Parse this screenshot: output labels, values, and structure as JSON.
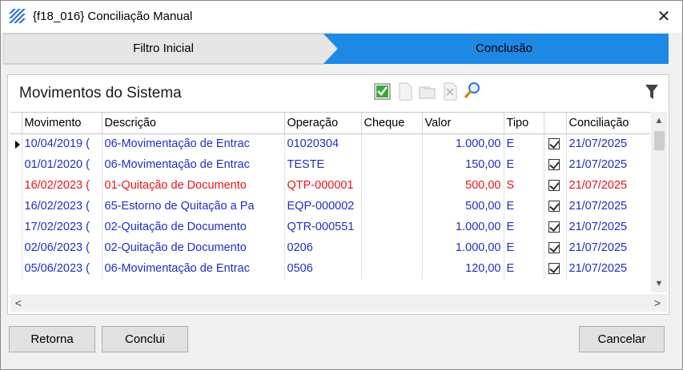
{
  "window": {
    "title": "{f18_016}  Conciliação Manual",
    "close_glyph": "✕",
    "icon": "app-logo-icon"
  },
  "wizard": {
    "steps": [
      {
        "label": "Filtro Inicial",
        "active": false
      },
      {
        "label": "Conclusão",
        "active": true
      }
    ],
    "active_color": "#1e88e5",
    "inactive_color": "#e6e6e6"
  },
  "panel": {
    "title": "Movimentos do Sistema",
    "toolbar_icons": [
      "check-all-icon",
      "new-document-icon",
      "open-folder-icon",
      "delete-document-icon",
      "search-icon"
    ],
    "filter_icon": "filter-icon"
  },
  "grid": {
    "columns": [
      "Movimento",
      "Descrição",
      "Operação",
      "Cheque",
      "Valor",
      "Tipo",
      "",
      "Conciliação"
    ],
    "rows": [
      {
        "movimento": "10/04/2019 (",
        "descricao": "06-Movimentação de Entrac",
        "operacao": "01020304",
        "cheque": "",
        "valor": "1.000,00",
        "tipo": "E",
        "checked": true,
        "conciliacao": "21/07/2025",
        "color": "#1f2fbf",
        "current": true
      },
      {
        "movimento": "01/01/2020 (",
        "descricao": "06-Movimentação de Entrac",
        "operacao": "TESTE",
        "cheque": "",
        "valor": "150,00",
        "tipo": "E",
        "checked": true,
        "conciliacao": "21/07/2025",
        "color": "#1f2fbf",
        "current": false
      },
      {
        "movimento": "16/02/2023 (",
        "descricao": "01-Quitação de Documento",
        "operacao": "QTP-000001",
        "cheque": "",
        "valor": "500,00",
        "tipo": "S",
        "checked": true,
        "conciliacao": "21/07/2025",
        "color": "#e8141b",
        "current": false
      },
      {
        "movimento": "16/02/2023 (",
        "descricao": "65-Estorno de Quitação a Pa",
        "operacao": "EQP-000002",
        "cheque": "",
        "valor": "500,00",
        "tipo": "E",
        "checked": true,
        "conciliacao": "21/07/2025",
        "color": "#1f2fbf",
        "current": false
      },
      {
        "movimento": "17/02/2023 (",
        "descricao": "02-Quitação de Documento",
        "operacao": "QTR-000551",
        "cheque": "",
        "valor": "1.000,00",
        "tipo": "E",
        "checked": true,
        "conciliacao": "21/07/2025",
        "color": "#1f2fbf",
        "current": false
      },
      {
        "movimento": "02/06/2023 (",
        "descricao": "02-Quitação de Documento",
        "operacao": "0206",
        "cheque": "",
        "valor": "1.000,00",
        "tipo": "E",
        "checked": true,
        "conciliacao": "21/07/2025",
        "color": "#1f2fbf",
        "current": false
      },
      {
        "movimento": "05/06/2023 (",
        "descricao": "06-Movimentação de Entrac",
        "operacao": "0506",
        "cheque": "",
        "valor": "120,00",
        "tipo": "E",
        "checked": true,
        "conciliacao": "21/07/2025",
        "color": "#1f2fbf",
        "current": false
      }
    ]
  },
  "scrollbars": {
    "up": "▲",
    "down": "▼",
    "left": "<",
    "right": ">"
  },
  "buttons": {
    "retorna": "Retorna",
    "conclui": "Conclui",
    "cancelar": "Cancelar"
  }
}
